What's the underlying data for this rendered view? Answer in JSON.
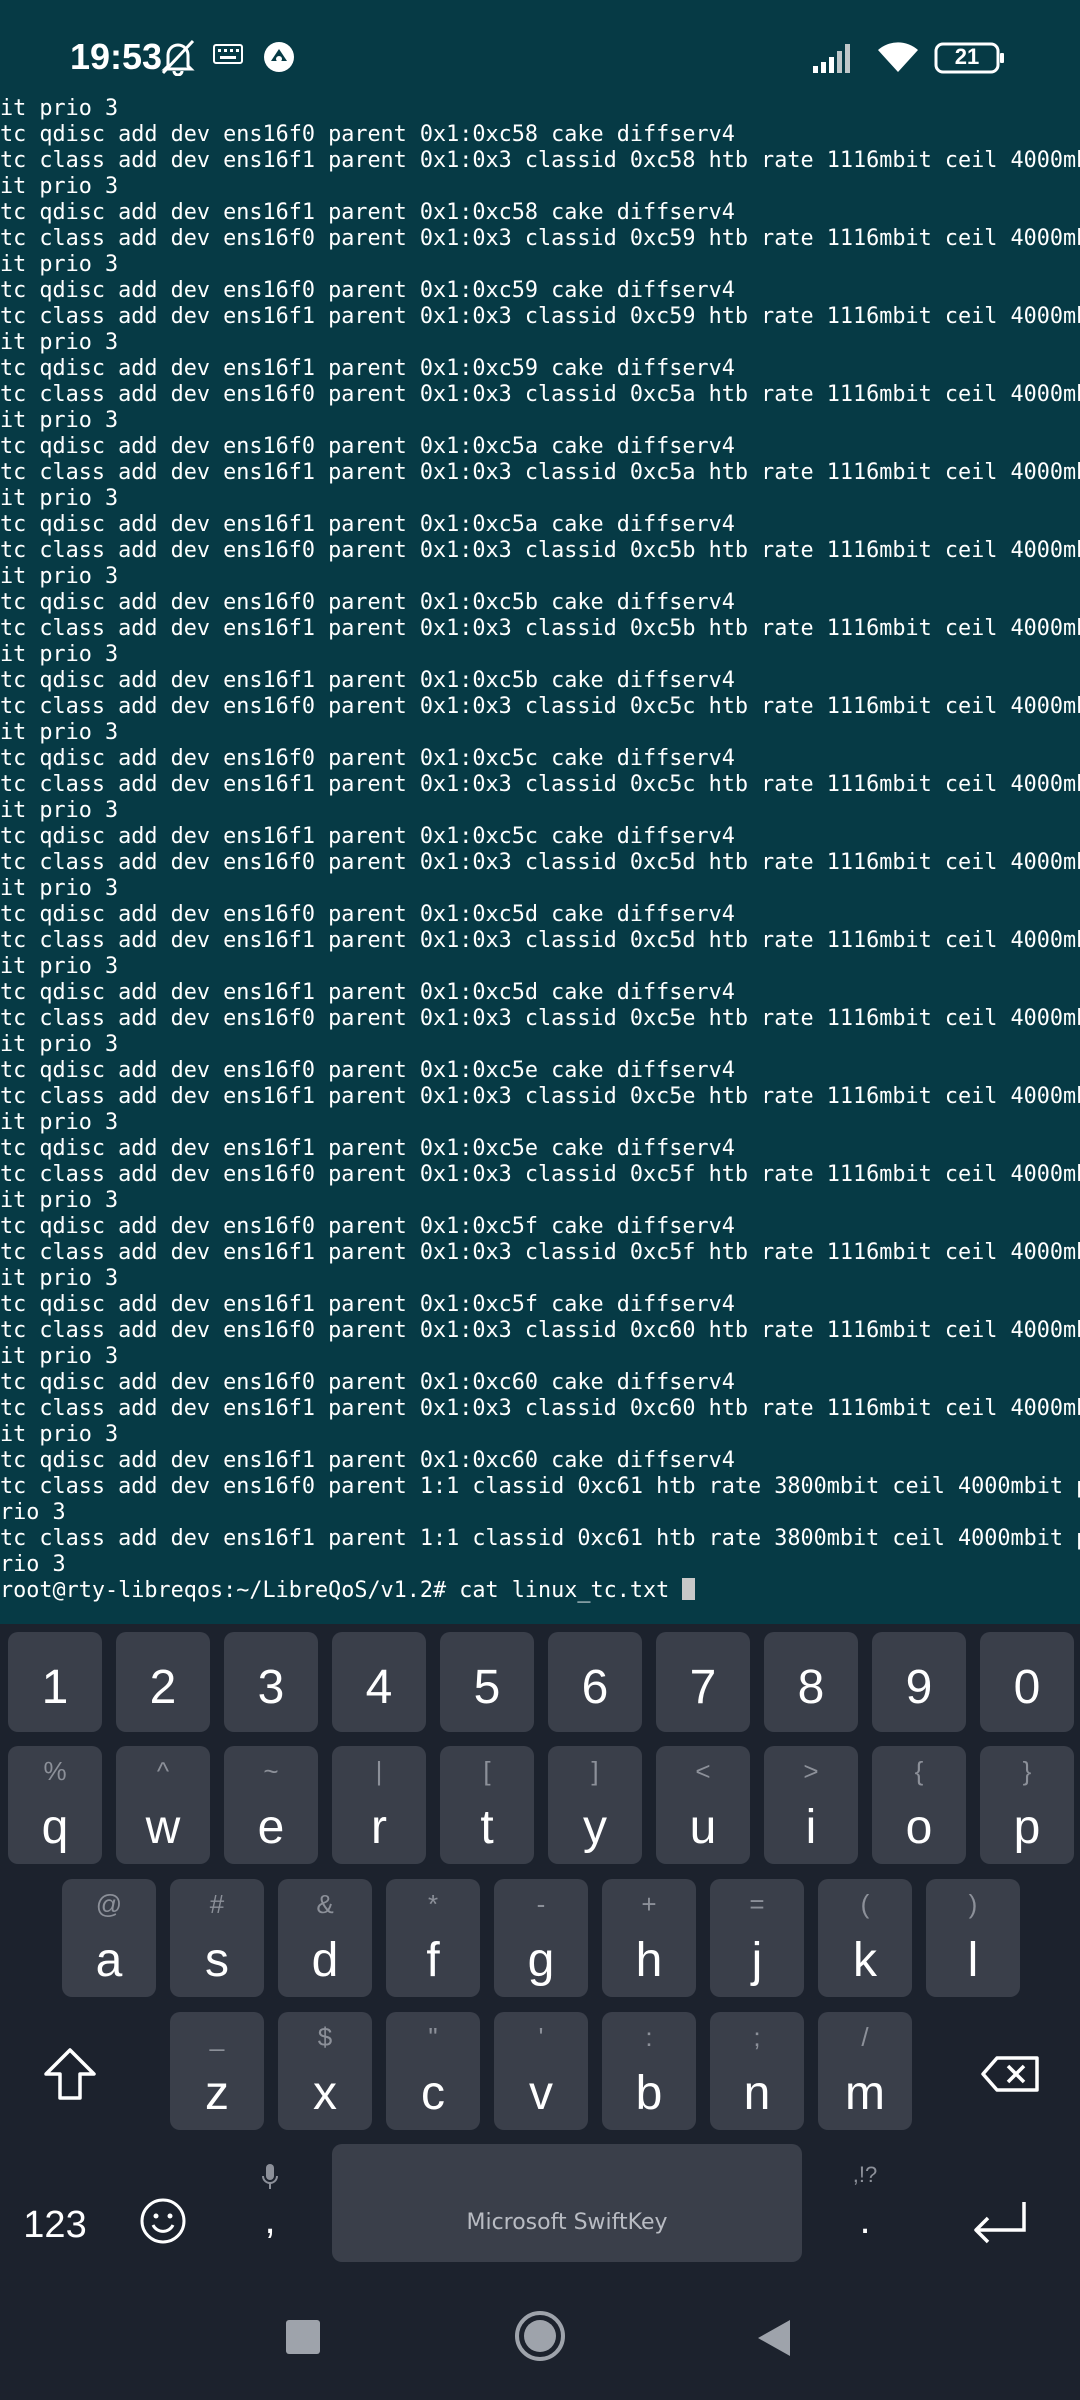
{
  "status_bar": {
    "time": "19:53",
    "battery": "21",
    "icons": [
      "notifications-off-icon",
      "keyboard-icon",
      "app-notification-icon",
      "signal-icon",
      "wifi-icon",
      "battery-icon"
    ]
  },
  "terminal": {
    "lines": [
      "it prio 3",
      "tc qdisc add dev ens16f0 parent 0x1:0xc58 cake diffserv4",
      "tc class add dev ens16f1 parent 0x1:0x3 classid 0xc58 htb rate 1116mbit ceil 4000mb",
      "it prio 3",
      "tc qdisc add dev ens16f1 parent 0x1:0xc58 cake diffserv4",
      "tc class add dev ens16f0 parent 0x1:0x3 classid 0xc59 htb rate 1116mbit ceil 4000mb",
      "it prio 3",
      "tc qdisc add dev ens16f0 parent 0x1:0xc59 cake diffserv4",
      "tc class add dev ens16f1 parent 0x1:0x3 classid 0xc59 htb rate 1116mbit ceil 4000mb",
      "it prio 3",
      "tc qdisc add dev ens16f1 parent 0x1:0xc59 cake diffserv4",
      "tc class add dev ens16f0 parent 0x1:0x3 classid 0xc5a htb rate 1116mbit ceil 4000mb",
      "it prio 3",
      "tc qdisc add dev ens16f0 parent 0x1:0xc5a cake diffserv4",
      "tc class add dev ens16f1 parent 0x1:0x3 classid 0xc5a htb rate 1116mbit ceil 4000mb",
      "it prio 3",
      "tc qdisc add dev ens16f1 parent 0x1:0xc5a cake diffserv4",
      "tc class add dev ens16f0 parent 0x1:0x3 classid 0xc5b htb rate 1116mbit ceil 4000mb",
      "it prio 3",
      "tc qdisc add dev ens16f0 parent 0x1:0xc5b cake diffserv4",
      "tc class add dev ens16f1 parent 0x1:0x3 classid 0xc5b htb rate 1116mbit ceil 4000mb",
      "it prio 3",
      "tc qdisc add dev ens16f1 parent 0x1:0xc5b cake diffserv4",
      "tc class add dev ens16f0 parent 0x1:0x3 classid 0xc5c htb rate 1116mbit ceil 4000mb",
      "it prio 3",
      "tc qdisc add dev ens16f0 parent 0x1:0xc5c cake diffserv4",
      "tc class add dev ens16f1 parent 0x1:0x3 classid 0xc5c htb rate 1116mbit ceil 4000mb",
      "it prio 3",
      "tc qdisc add dev ens16f1 parent 0x1:0xc5c cake diffserv4",
      "tc class add dev ens16f0 parent 0x1:0x3 classid 0xc5d htb rate 1116mbit ceil 4000mb",
      "it prio 3",
      "tc qdisc add dev ens16f0 parent 0x1:0xc5d cake diffserv4",
      "tc class add dev ens16f1 parent 0x1:0x3 classid 0xc5d htb rate 1116mbit ceil 4000mb",
      "it prio 3",
      "tc qdisc add dev ens16f1 parent 0x1:0xc5d cake diffserv4",
      "tc class add dev ens16f0 parent 0x1:0x3 classid 0xc5e htb rate 1116mbit ceil 4000mb",
      "it prio 3",
      "tc qdisc add dev ens16f0 parent 0x1:0xc5e cake diffserv4",
      "tc class add dev ens16f1 parent 0x1:0x3 classid 0xc5e htb rate 1116mbit ceil 4000mb",
      "it prio 3",
      "tc qdisc add dev ens16f1 parent 0x1:0xc5e cake diffserv4",
      "tc class add dev ens16f0 parent 0x1:0x3 classid 0xc5f htb rate 1116mbit ceil 4000mb",
      "it prio 3",
      "tc qdisc add dev ens16f0 parent 0x1:0xc5f cake diffserv4",
      "tc class add dev ens16f1 parent 0x1:0x3 classid 0xc5f htb rate 1116mbit ceil 4000mb",
      "it prio 3",
      "tc qdisc add dev ens16f1 parent 0x1:0xc5f cake diffserv4",
      "tc class add dev ens16f0 parent 0x1:0x3 classid 0xc60 htb rate 1116mbit ceil 4000mb",
      "it prio 3",
      "tc qdisc add dev ens16f0 parent 0x1:0xc60 cake diffserv4",
      "tc class add dev ens16f1 parent 0x1:0x3 classid 0xc60 htb rate 1116mbit ceil 4000mb",
      "it prio 3",
      "tc qdisc add dev ens16f1 parent 0x1:0xc60 cake diffserv4",
      "tc class add dev ens16f0 parent 1:1 classid 0xc61 htb rate 3800mbit ceil 4000mbit p",
      "rio 3",
      "tc class add dev ens16f1 parent 1:1 classid 0xc61 htb rate 3800mbit ceil 4000mbit p",
      "rio 3"
    ],
    "prompt": "root@rty-libreqos:~/LibreQoS/v1.2# cat linux_tc.txt "
  },
  "keyboard": {
    "number_row": [
      "1",
      "2",
      "3",
      "4",
      "5",
      "6",
      "7",
      "8",
      "9",
      "0"
    ],
    "row1": [
      {
        "main": "q",
        "sec": "%"
      },
      {
        "main": "w",
        "sec": "^"
      },
      {
        "main": "e",
        "sec": "~"
      },
      {
        "main": "r",
        "sec": "|"
      },
      {
        "main": "t",
        "sec": "["
      },
      {
        "main": "y",
        "sec": "]"
      },
      {
        "main": "u",
        "sec": "<"
      },
      {
        "main": "i",
        "sec": ">"
      },
      {
        "main": "o",
        "sec": "{"
      },
      {
        "main": "p",
        "sec": "}"
      }
    ],
    "row2": [
      {
        "main": "a",
        "sec": "@"
      },
      {
        "main": "s",
        "sec": "#"
      },
      {
        "main": "d",
        "sec": "&"
      },
      {
        "main": "f",
        "sec": "*"
      },
      {
        "main": "g",
        "sec": "-"
      },
      {
        "main": "h",
        "sec": "+"
      },
      {
        "main": "j",
        "sec": "="
      },
      {
        "main": "k",
        "sec": "("
      },
      {
        "main": "l",
        "sec": ")"
      }
    ],
    "row3": [
      {
        "main": "z",
        "sec": "_"
      },
      {
        "main": "x",
        "sec": "$"
      },
      {
        "main": "c",
        "sec": "\""
      },
      {
        "main": "v",
        "sec": "'"
      },
      {
        "main": "b",
        "sec": ":"
      },
      {
        "main": "n",
        "sec": ";"
      },
      {
        "main": "m",
        "sec": "/"
      }
    ],
    "symbols_label": "123",
    "comma": ",",
    "period": ".",
    "period_hint": ",!?",
    "space_label": "Microsoft SwiftKey"
  },
  "navbar": {
    "icons": [
      "recents-icon",
      "home-icon",
      "back-icon"
    ]
  }
}
